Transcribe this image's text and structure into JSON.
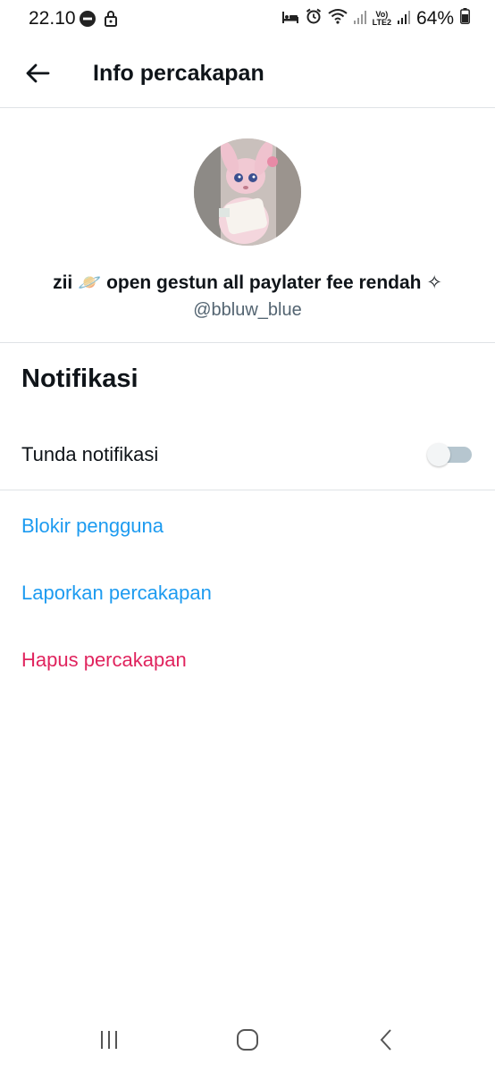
{
  "status_bar": {
    "time": "22.10",
    "battery": "64%",
    "network": "LTE2"
  },
  "header": {
    "title": "Info percakapan"
  },
  "profile": {
    "display_name": "zii 🪐 open gestun all paylater fee rendah ✧",
    "handle": "@bbluw_blue"
  },
  "notifications": {
    "heading": "Notifikasi",
    "snooze_label": "Tunda notifikasi",
    "snooze_enabled": false
  },
  "actions": {
    "block": "Blokir pengguna",
    "report": "Laporkan percakapan",
    "delete": "Hapus percakapan"
  },
  "colors": {
    "link": "#1d9bf0",
    "danger": "#e0245e",
    "divider": "#dfe3e6",
    "secondary_text": "#536471"
  }
}
